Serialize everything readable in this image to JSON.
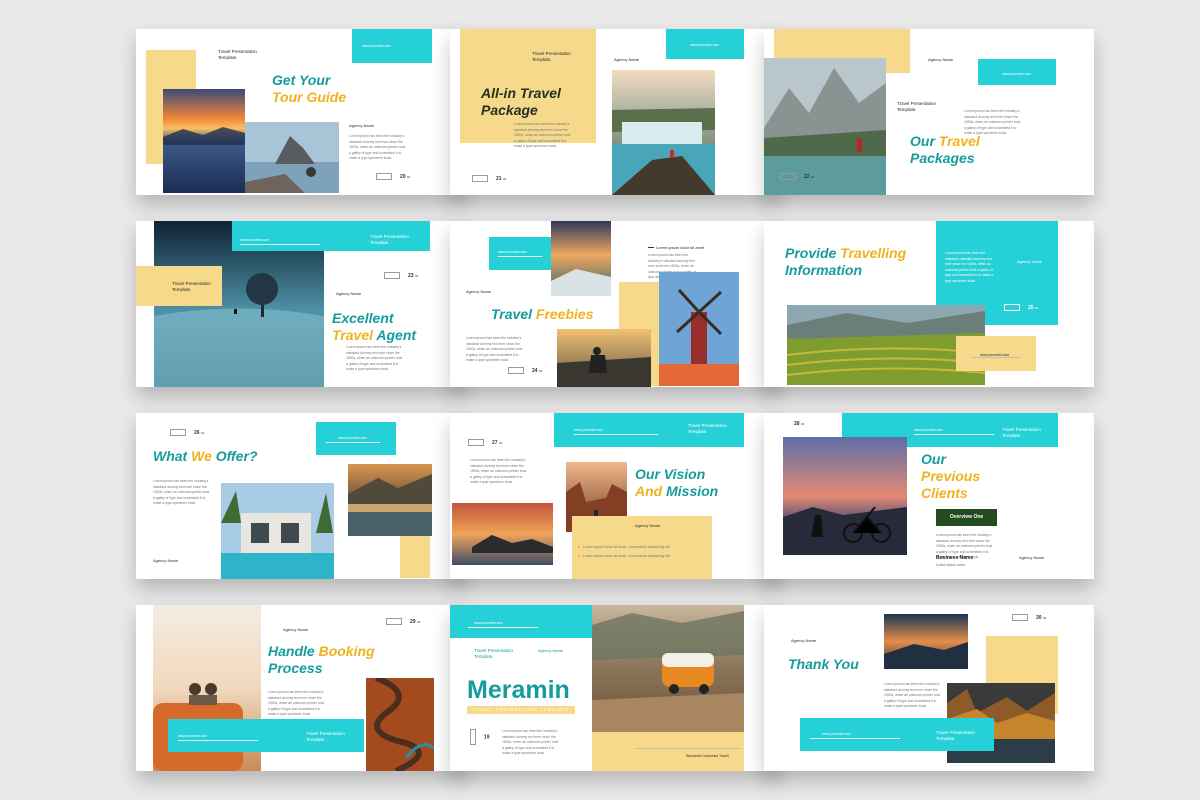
{
  "template": {
    "tag": "Travel Presentation",
    "tag2": "Template.",
    "agency": "Agency Name",
    "url": "www.yourweb.com",
    "body": "Lorem ipsum has been the industry's standard dummy text ever since the 1500s, when an unknown printer took a galley of type and scrambled it to make a type specimen book.",
    "bullet": "Lorem ipsum dolor sit amet, consectetur adipiscing elit."
  },
  "slides": {
    "s1": {
      "t1": "Get Your",
      "t2": "Tour Guide",
      "page": "20"
    },
    "s2": {
      "t1": "All-in Travel",
      "t2": "Package",
      "page": "21"
    },
    "s3": {
      "t1a": "Our ",
      "t1b": "Travel",
      "t2": "Packages",
      "page": "22"
    },
    "s4": {
      "t1": "Excellent",
      "t2a": "Travel ",
      "t2b": "Agent",
      "page": "23"
    },
    "s5": {
      "t1a": "Travel ",
      "t1b": "Freebies",
      "page": "24",
      "note": "Lorem ipsum dolor sit amet"
    },
    "s6": {
      "t1a": "Provide ",
      "t1b": "Travelling",
      "t2": "Information",
      "page": "25"
    },
    "s7": {
      "t1a": "What ",
      "t1b": "We ",
      "t1c": "Offer?",
      "page": "26"
    },
    "s8": {
      "t1": "Our Vision",
      "t2a": "And ",
      "t2b": "Mission",
      "page": "27"
    },
    "s9": {
      "t1": "Our",
      "t2": "Previous",
      "t3": "Clients",
      "page": "28",
      "button": "Overview One",
      "business": "Business Name",
      "subline": "Lorem ipsum dolor"
    },
    "s10": {
      "t1a": "Handle ",
      "t1b": "Booking",
      "t2": "Process",
      "page": "29"
    },
    "s11": {
      "brand": "Meramin",
      "sub": "TRAVEL PRESENTATION TEMPLATE",
      "page": "19",
      "footer": "Wonderful Indonesia Travel"
    },
    "s12": {
      "t1": "Thank You",
      "page": "30"
    }
  },
  "page_suffix": "02",
  "colors": {
    "accent_cyan": "#25d0d6",
    "accent_yellow": "#f6d98b",
    "title_teal": "#169c9c",
    "title_gold": "#f0b21c",
    "dark_green": "#244a1f",
    "background": "#e9e9e9"
  }
}
